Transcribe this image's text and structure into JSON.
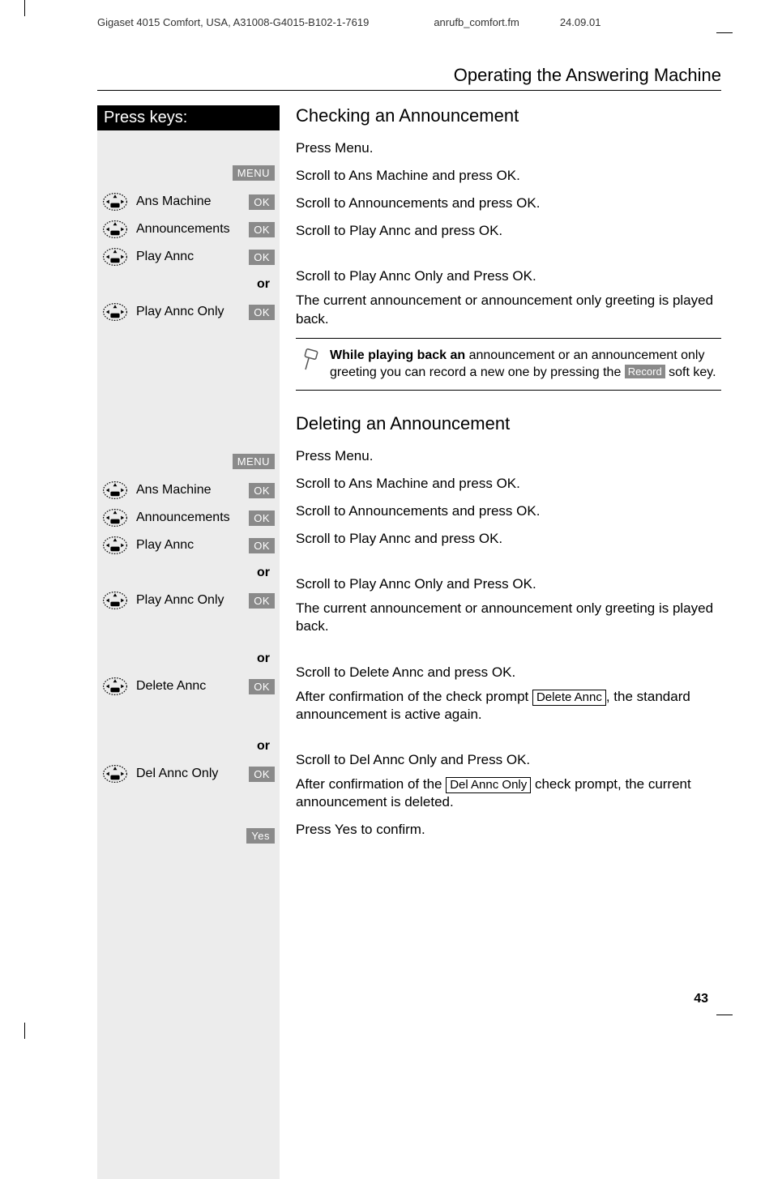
{
  "header": {
    "product": "Gigaset 4015 Comfort, USA, A31008-G4015-B102-1-7619",
    "file": "anrufb_comfort.fm",
    "date": "24.09.01"
  },
  "section_title": "Operating the Answering Machine",
  "left": {
    "press_keys": "Press keys:",
    "menu": "MENU",
    "ok": "OK",
    "yes": "Yes",
    "or": "or",
    "items": {
      "ans_machine": "Ans Machine",
      "announcements": "Announcements",
      "play_annc": "Play Annc",
      "play_annc_only": "Play Annc Only",
      "delete_annc": "Delete Annc",
      "del_annc_only": "Del Annc Only"
    }
  },
  "right": {
    "h1": "Checking an Announcement",
    "p1": "Press Menu.",
    "p2": "Scroll to Ans Machine and press OK.",
    "p3": "Scroll to Announcements and press OK.",
    "p4": "Scroll to Play Annc and press OK.",
    "p5": "Scroll to Play Annc Only and Press OK.",
    "p6": "The current announcement or announcement only greeting is played back.",
    "note_bold": "While playing back an",
    "note_rest1": " announcement or an announcement only greeting you can record a new one by pressing the ",
    "note_key": "Record",
    "note_rest2": " soft key.",
    "h2": "Deleting an Announcement",
    "d1": "Press Menu.",
    "d2": "Scroll to Ans Machine and press OK.",
    "d3": "Scroll to Announcements and press OK.",
    "d4": "Scroll to Play Annc and press OK.",
    "d5": "Scroll to Play Annc Only and Press OK.",
    "d6": "The current announcement or announcement only greeting is played back.",
    "d7": "Scroll to Delete Annc and press OK.",
    "d8a": "After confirmation of the check prompt ",
    "d8box": "Delete Annc",
    "d8b": ", the standard announcement is active again.",
    "d9": "Scroll to Del Annc Only and Press OK.",
    "d10a": "After confirmation of the ",
    "d10box": "Del Annc Only",
    "d10b": " check prompt, the current announcement is deleted.",
    "d11": "Press Yes to confirm."
  },
  "page_number": "43"
}
